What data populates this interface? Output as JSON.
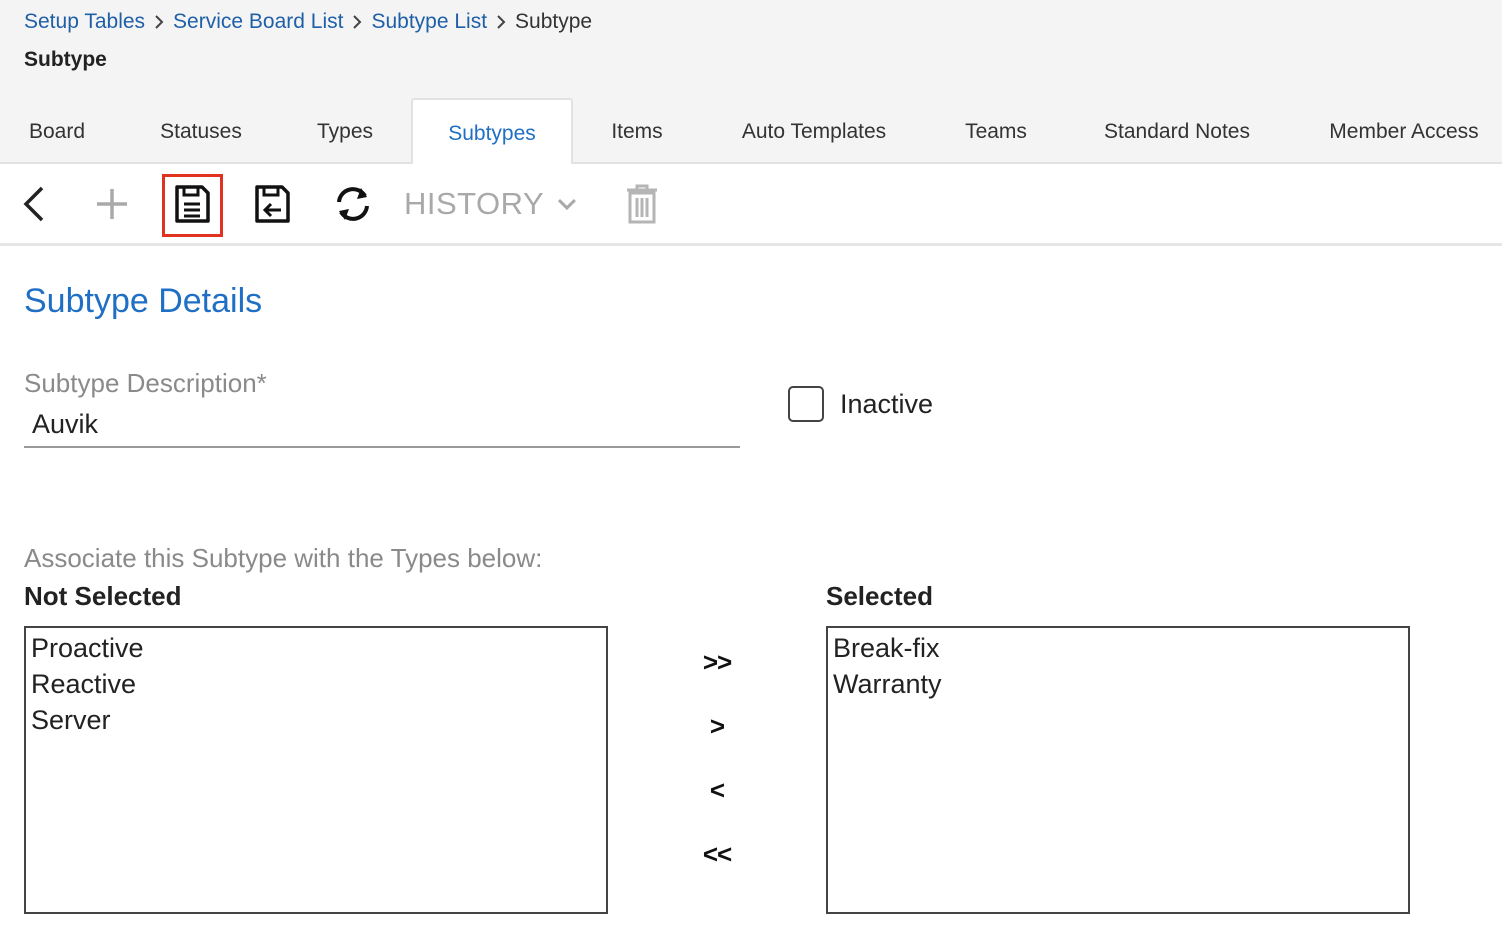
{
  "breadcrumb": {
    "items": [
      {
        "label": "Setup Tables",
        "link": true
      },
      {
        "label": "Service Board List",
        "link": true
      },
      {
        "label": "Subtype List",
        "link": true
      },
      {
        "label": "Subtype",
        "link": false
      }
    ]
  },
  "page_title": "Subtype",
  "tabs": [
    {
      "label": "Board",
      "active": false
    },
    {
      "label": "Statuses",
      "active": false
    },
    {
      "label": "Types",
      "active": false
    },
    {
      "label": "Subtypes",
      "active": true
    },
    {
      "label": "Items",
      "active": false
    },
    {
      "label": "Auto Templates",
      "active": false
    },
    {
      "label": "Teams",
      "active": false
    },
    {
      "label": "Standard Notes",
      "active": false
    },
    {
      "label": "Member Access",
      "active": false
    }
  ],
  "toolbar": {
    "back_icon": "chevron-left-icon",
    "add_icon": "plus-icon",
    "save_icon": "save-icon",
    "save_close_icon": "save-close-icon",
    "refresh_icon": "refresh-icon",
    "history_label": "HISTORY",
    "history_icon": "chevron-down-icon",
    "delete_icon": "trash-icon"
  },
  "details": {
    "section_title": "Subtype Details",
    "description_label": "Subtype Description*",
    "description_value": "Auvik",
    "inactive_label": "Inactive",
    "inactive_checked": false
  },
  "association": {
    "label": "Associate this Subtype with the Types below:",
    "not_selected_label": "Not Selected",
    "selected_label": "Selected",
    "not_selected": [
      "Proactive",
      "Reactive",
      "Server"
    ],
    "selected": [
      "Break-fix",
      "Warranty"
    ],
    "move_all_right": ">>",
    "move_right": ">",
    "move_left": "<",
    "move_all_left": "<<"
  },
  "colors": {
    "link": "#1f5fa8",
    "accent": "#1f6fc4",
    "highlight": "#e0321f",
    "header_bg": "#f4f4f4"
  }
}
